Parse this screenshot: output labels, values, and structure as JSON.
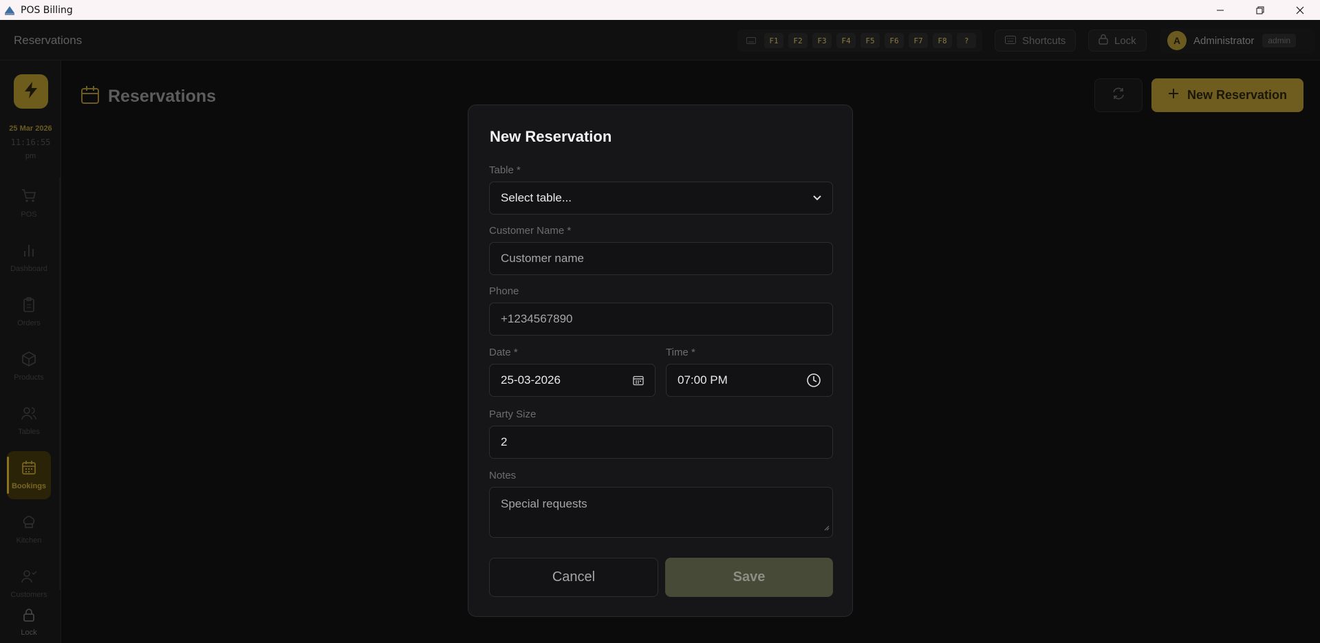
{
  "window": {
    "title": "POS Billing"
  },
  "header": {
    "title": "Reservations",
    "fkeys": [
      "F1",
      "F2",
      "F3",
      "F4",
      "F5",
      "F6",
      "F7",
      "F8",
      "?"
    ],
    "shortcuts_label": "Shortcuts",
    "lock_label": "Lock",
    "user": {
      "initial": "A",
      "name": "Administrator",
      "role": "admin"
    }
  },
  "sidebar": {
    "date": "25 Mar 2026",
    "time": "11:16:55",
    "ampm": "pm",
    "items": [
      {
        "label": "POS",
        "icon": "cart-icon"
      },
      {
        "label": "Dashboard",
        "icon": "bar-chart-icon"
      },
      {
        "label": "Orders",
        "icon": "clipboard-icon"
      },
      {
        "label": "Products",
        "icon": "box-icon"
      },
      {
        "label": "Tables",
        "icon": "users-icon"
      },
      {
        "label": "Bookings",
        "icon": "calendar-icon",
        "active": true
      },
      {
        "label": "Kitchen",
        "icon": "chef-hat-icon"
      },
      {
        "label": "Customers",
        "icon": "customers-icon"
      }
    ],
    "lock_label": "Lock"
  },
  "page": {
    "title": "Reservations",
    "new_button": "New Reservation"
  },
  "modal": {
    "title": "New Reservation",
    "table_label": "Table *",
    "table_value": "Select table...",
    "customer_label": "Customer Name *",
    "customer_placeholder": "Customer name",
    "phone_label": "Phone",
    "phone_placeholder": "+1234567890",
    "date_label": "Date *",
    "date_value": "25-03-2026",
    "time_label": "Time *",
    "time_value": "07:00 PM",
    "party_label": "Party Size",
    "party_value": "2",
    "notes_label": "Notes",
    "notes_placeholder": "Special requests",
    "cancel": "Cancel",
    "save": "Save"
  },
  "colors": {
    "accent": "#6f5d1f",
    "accent_text": "#7a6623",
    "modal_bg": "#161618",
    "save_disabled": "#474a37"
  }
}
